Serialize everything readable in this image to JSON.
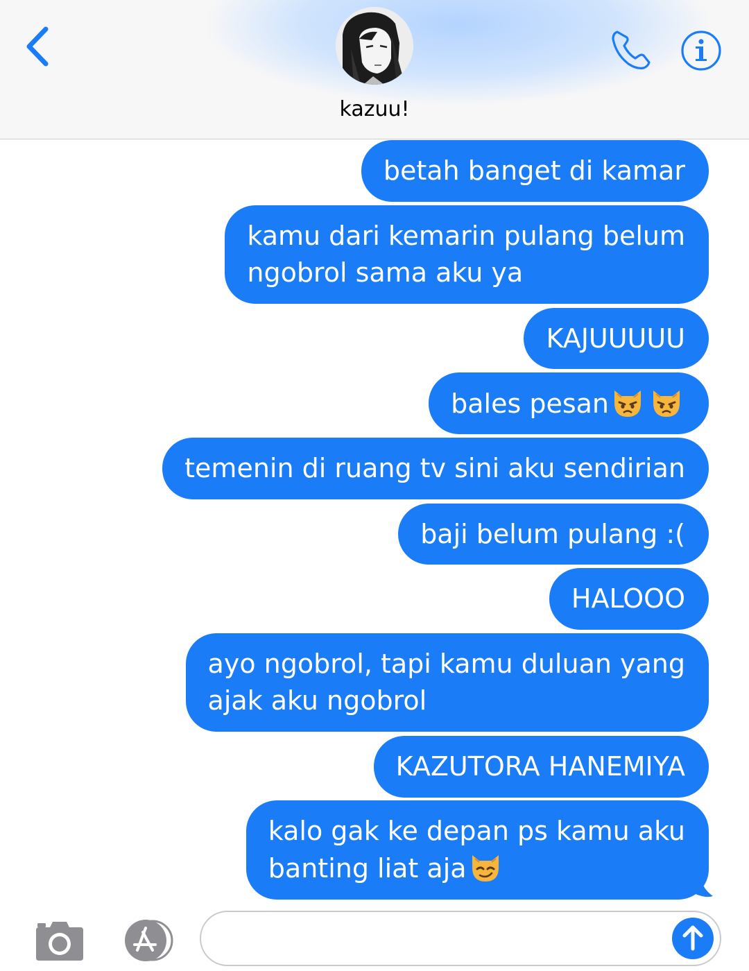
{
  "header": {
    "contact_name": "kazuu!",
    "back_icon": "chevron-left-icon",
    "call_icon": "phone-icon",
    "info_icon": "info-icon",
    "accent_color": "#1a7cf6"
  },
  "messages": [
    {
      "text": "betah banget di kamar",
      "direction": "sent"
    },
    {
      "line1": "kamu dari kemarin pulang belum",
      "line2": "ngobrol sama aku ya",
      "direction": "sent"
    },
    {
      "text": "KAJUUUUU",
      "direction": "sent"
    },
    {
      "text": "bales pesan",
      "emoji": "pouting-cat-face x2",
      "direction": "sent"
    },
    {
      "text": "temenin di ruang tv sini aku sendirian",
      "direction": "sent"
    },
    {
      "text": "baji belum pulang :(",
      "direction": "sent"
    },
    {
      "text": "HALOOO",
      "direction": "sent"
    },
    {
      "line1": "ayo ngobrol, tapi kamu duluan yang",
      "line2": "ajak aku ngobrol",
      "direction": "sent"
    },
    {
      "text": "KAZUTORA HANEMIYA",
      "direction": "sent"
    },
    {
      "line1": "kalo gak ke depan ps kamu aku",
      "line2": "banting liat aja",
      "emoji": "smirking-cat-face",
      "direction": "sent"
    }
  ],
  "input_bar": {
    "placeholder": "",
    "camera_icon": "camera-icon",
    "apps_icon": "app-store-icon",
    "send_icon": "send-arrow-up-icon"
  },
  "bubble_color": "#1a7cf6"
}
